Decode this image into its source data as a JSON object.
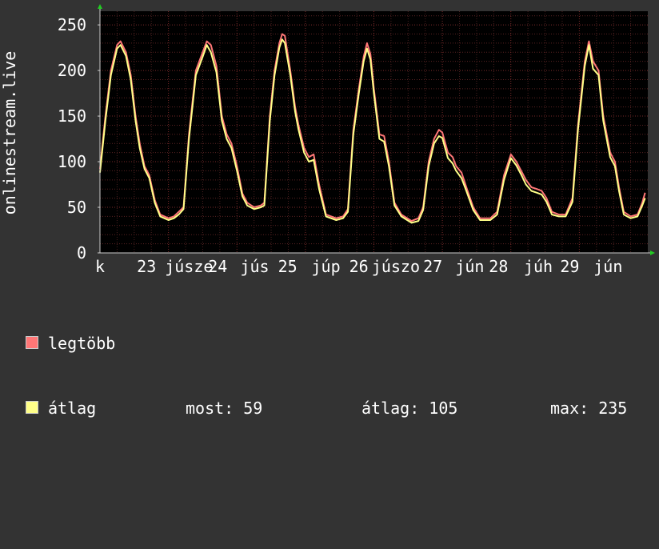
{
  "chart_data": {
    "type": "line",
    "ylabel": "onlinestream.live",
    "ylim": [
      0,
      265
    ],
    "yticks": [
      0,
      50,
      100,
      150,
      200,
      250
    ],
    "xticks": [
      {
        "label": "k",
        "x": 0
      },
      {
        "label": "23",
        "x": 0.68
      },
      {
        "label": "júsze",
        "x": 1.3
      },
      {
        "label": "24",
        "x": 1.72
      },
      {
        "label": "jús",
        "x": 2.26
      },
      {
        "label": "25",
        "x": 2.74
      },
      {
        "label": "júp",
        "x": 3.3
      },
      {
        "label": "26",
        "x": 3.78
      },
      {
        "label": "júszo",
        "x": 4.32
      },
      {
        "label": "27",
        "x": 4.86
      },
      {
        "label": "jún",
        "x": 5.4
      },
      {
        "label": "28",
        "x": 5.82
      },
      {
        "label": "júh",
        "x": 6.4
      },
      {
        "label": "29",
        "x": 6.86
      },
      {
        "label": "jún",
        "x": 7.42
      }
    ],
    "series": [
      {
        "name": "legtöbb",
        "color": "#ff7777",
        "points": [
          [
            0,
            92
          ],
          [
            0.08,
            150
          ],
          [
            0.16,
            200
          ],
          [
            0.25,
            228
          ],
          [
            0.3,
            232
          ],
          [
            0.38,
            220
          ],
          [
            0.45,
            195
          ],
          [
            0.52,
            150
          ],
          [
            0.58,
            120
          ],
          [
            0.65,
            95
          ],
          [
            0.72,
            85
          ],
          [
            0.8,
            58
          ],
          [
            0.88,
            42
          ],
          [
            1.0,
            38
          ],
          [
            1.08,
            40
          ],
          [
            1.15,
            45
          ],
          [
            1.22,
            50
          ],
          [
            1.3,
            130
          ],
          [
            1.4,
            200
          ],
          [
            1.5,
            220
          ],
          [
            1.56,
            232
          ],
          [
            1.62,
            228
          ],
          [
            1.7,
            205
          ],
          [
            1.78,
            150
          ],
          [
            1.85,
            130
          ],
          [
            1.92,
            120
          ],
          [
            2.0,
            95
          ],
          [
            2.08,
            65
          ],
          [
            2.15,
            55
          ],
          [
            2.25,
            50
          ],
          [
            2.35,
            52
          ],
          [
            2.4,
            55
          ],
          [
            2.48,
            150
          ],
          [
            2.55,
            200
          ],
          [
            2.62,
            230
          ],
          [
            2.66,
            240
          ],
          [
            2.7,
            238
          ],
          [
            2.78,
            200
          ],
          [
            2.85,
            160
          ],
          [
            2.9,
            140
          ],
          [
            2.98,
            115
          ],
          [
            3.05,
            105
          ],
          [
            3.12,
            108
          ],
          [
            3.2,
            75
          ],
          [
            3.3,
            42
          ],
          [
            3.45,
            38
          ],
          [
            3.55,
            40
          ],
          [
            3.62,
            48
          ],
          [
            3.7,
            135
          ],
          [
            3.78,
            180
          ],
          [
            3.85,
            215
          ],
          [
            3.9,
            230
          ],
          [
            3.95,
            218
          ],
          [
            4.0,
            180
          ],
          [
            4.08,
            130
          ],
          [
            4.15,
            128
          ],
          [
            4.22,
            100
          ],
          [
            4.3,
            55
          ],
          [
            4.4,
            42
          ],
          [
            4.55,
            35
          ],
          [
            4.65,
            38
          ],
          [
            4.72,
            50
          ],
          [
            4.8,
            100
          ],
          [
            4.88,
            125
          ],
          [
            4.95,
            135
          ],
          [
            5.0,
            132
          ],
          [
            5.08,
            110
          ],
          [
            5.15,
            105
          ],
          [
            5.2,
            95
          ],
          [
            5.28,
            88
          ],
          [
            5.35,
            72
          ],
          [
            5.45,
            50
          ],
          [
            5.55,
            38
          ],
          [
            5.7,
            38
          ],
          [
            5.8,
            45
          ],
          [
            5.9,
            85
          ],
          [
            6.0,
            108
          ],
          [
            6.08,
            100
          ],
          [
            6.15,
            90
          ],
          [
            6.22,
            80
          ],
          [
            6.3,
            72
          ],
          [
            6.38,
            70
          ],
          [
            6.45,
            68
          ],
          [
            6.52,
            60
          ],
          [
            6.6,
            45
          ],
          [
            6.7,
            42
          ],
          [
            6.8,
            42
          ],
          [
            6.9,
            60
          ],
          [
            6.98,
            140
          ],
          [
            7.08,
            210
          ],
          [
            7.14,
            232
          ],
          [
            7.2,
            210
          ],
          [
            7.28,
            200
          ],
          [
            7.35,
            150
          ],
          [
            7.45,
            110
          ],
          [
            7.52,
            100
          ],
          [
            7.58,
            72
          ],
          [
            7.65,
            45
          ],
          [
            7.75,
            40
          ],
          [
            7.85,
            42
          ],
          [
            7.92,
            55
          ],
          [
            7.96,
            66
          ]
        ]
      },
      {
        "name": "átlag",
        "color": "#ffff88",
        "points": [
          [
            0,
            88
          ],
          [
            0.08,
            145
          ],
          [
            0.16,
            195
          ],
          [
            0.25,
            224
          ],
          [
            0.3,
            228
          ],
          [
            0.38,
            216
          ],
          [
            0.45,
            190
          ],
          [
            0.52,
            145
          ],
          [
            0.58,
            115
          ],
          [
            0.65,
            92
          ],
          [
            0.72,
            82
          ],
          [
            0.8,
            55
          ],
          [
            0.88,
            40
          ],
          [
            1.0,
            36
          ],
          [
            1.08,
            38
          ],
          [
            1.15,
            42
          ],
          [
            1.22,
            48
          ],
          [
            1.3,
            125
          ],
          [
            1.4,
            195
          ],
          [
            1.5,
            215
          ],
          [
            1.56,
            228
          ],
          [
            1.62,
            220
          ],
          [
            1.7,
            198
          ],
          [
            1.78,
            145
          ],
          [
            1.85,
            125
          ],
          [
            1.92,
            115
          ],
          [
            2.0,
            90
          ],
          [
            2.08,
            62
          ],
          [
            2.15,
            52
          ],
          [
            2.25,
            48
          ],
          [
            2.35,
            50
          ],
          [
            2.4,
            52
          ],
          [
            2.48,
            145
          ],
          [
            2.55,
            195
          ],
          [
            2.62,
            225
          ],
          [
            2.66,
            234
          ],
          [
            2.7,
            230
          ],
          [
            2.78,
            195
          ],
          [
            2.85,
            155
          ],
          [
            2.9,
            135
          ],
          [
            2.98,
            110
          ],
          [
            3.05,
            100
          ],
          [
            3.12,
            102
          ],
          [
            3.2,
            70
          ],
          [
            3.3,
            40
          ],
          [
            3.45,
            36
          ],
          [
            3.55,
            38
          ],
          [
            3.62,
            45
          ],
          [
            3.7,
            130
          ],
          [
            3.78,
            175
          ],
          [
            3.85,
            210
          ],
          [
            3.9,
            224
          ],
          [
            3.95,
            212
          ],
          [
            4.0,
            175
          ],
          [
            4.08,
            125
          ],
          [
            4.15,
            122
          ],
          [
            4.22,
            95
          ],
          [
            4.3,
            52
          ],
          [
            4.4,
            40
          ],
          [
            4.55,
            33
          ],
          [
            4.65,
            35
          ],
          [
            4.72,
            47
          ],
          [
            4.8,
            95
          ],
          [
            4.88,
            120
          ],
          [
            4.95,
            128
          ],
          [
            5.0,
            126
          ],
          [
            5.08,
            104
          ],
          [
            5.15,
            98
          ],
          [
            5.2,
            90
          ],
          [
            5.28,
            82
          ],
          [
            5.35,
            68
          ],
          [
            5.45,
            47
          ],
          [
            5.55,
            36
          ],
          [
            5.7,
            36
          ],
          [
            5.8,
            42
          ],
          [
            5.9,
            80
          ],
          [
            6.0,
            104
          ],
          [
            6.08,
            96
          ],
          [
            6.15,
            86
          ],
          [
            6.22,
            75
          ],
          [
            6.3,
            68
          ],
          [
            6.38,
            66
          ],
          [
            6.45,
            64
          ],
          [
            6.52,
            56
          ],
          [
            6.6,
            42
          ],
          [
            6.7,
            40
          ],
          [
            6.8,
            40
          ],
          [
            6.9,
            56
          ],
          [
            6.98,
            135
          ],
          [
            7.08,
            205
          ],
          [
            7.14,
            228
          ],
          [
            7.2,
            202
          ],
          [
            7.28,
            195
          ],
          [
            7.35,
            145
          ],
          [
            7.45,
            105
          ],
          [
            7.52,
            95
          ],
          [
            7.58,
            68
          ],
          [
            7.65,
            42
          ],
          [
            7.75,
            38
          ],
          [
            7.85,
            40
          ],
          [
            7.92,
            52
          ],
          [
            7.96,
            60
          ]
        ]
      }
    ],
    "grid": true,
    "legend": "bottom-left"
  },
  "legend": {
    "items": [
      {
        "label": "legtöbb",
        "color": "#ff7777"
      },
      {
        "label": "átlag",
        "color": "#ffff88"
      }
    ],
    "stats": {
      "most": "most: 59",
      "atlag": "átlag: 105",
      "max": "max: 235"
    }
  }
}
